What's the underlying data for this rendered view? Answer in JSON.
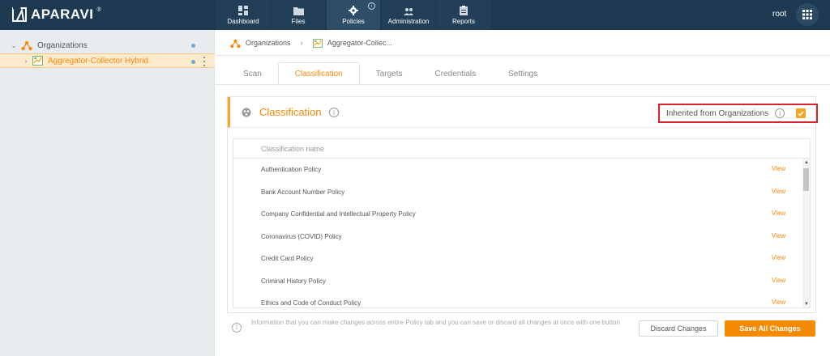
{
  "brand": {
    "name": "APARAVI",
    "reg": "®"
  },
  "nav": {
    "items": [
      {
        "label": "Dashboard",
        "icon": "dashboard-icon"
      },
      {
        "label": "Files",
        "icon": "folder-icon"
      },
      {
        "label": "Policies",
        "icon": "gear-icon",
        "active": true
      },
      {
        "label": "Administration",
        "icon": "users-icon"
      },
      {
        "label": "Reports",
        "icon": "clipboard-icon"
      }
    ],
    "policies_badge": "i"
  },
  "user": {
    "name": "root"
  },
  "sidebar": {
    "items": [
      {
        "label": "Organizations",
        "caret": "⌄"
      },
      {
        "label": "Aggregator-Collector Hybrid",
        "caret": "›",
        "selected": true
      }
    ]
  },
  "breadcrumb": {
    "items": [
      "Organizations",
      "Aggregator-Collec..."
    ],
    "separator": "›"
  },
  "tabs": [
    "Scan",
    "Classification",
    "Targets",
    "Credentials",
    "Settings"
  ],
  "active_tab": "Classification",
  "panel": {
    "title": "Classification",
    "info_glyph": "i",
    "inherited_label": "Inherited from Organizations",
    "inherited_checked": true
  },
  "table": {
    "header": "Classification name",
    "view_label": "View",
    "rows": [
      "Authentication Policy",
      "Bank Account Number Policy",
      "Company Confidential and Intellectual Property Policy",
      "Coronavirus (COVID) Policy",
      "Credit Card Policy",
      "Criminal History Policy",
      "Ethics and Code of Conduct Policy"
    ]
  },
  "footer": {
    "info_text": "Information that you can make changes across entire Policy tab and you can save or discard all changes at once with one button",
    "discard_label": "Discard Changes",
    "save_label": "Save All Changes"
  },
  "colors": {
    "topbar": "#1e3a52",
    "accent": "#f58a07",
    "highlight_border": "#d9232e",
    "sidebar_bg": "#e8ecef"
  }
}
